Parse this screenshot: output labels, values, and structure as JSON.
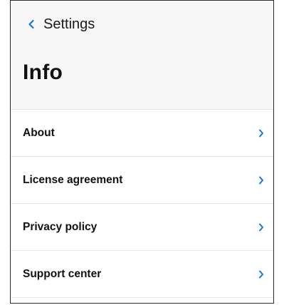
{
  "nav": {
    "back_label": "Settings",
    "back_icon": "chevron-left-icon"
  },
  "page": {
    "title": "Info"
  },
  "items": [
    {
      "label": "About",
      "icon": "chevron-right-icon"
    },
    {
      "label": "License agreement",
      "icon": "chevron-right-icon"
    },
    {
      "label": "Privacy policy",
      "icon": "chevron-right-icon"
    },
    {
      "label": "Support center",
      "icon": "chevron-right-icon"
    }
  ],
  "colors": {
    "accent": "#1a73e8",
    "text": "#111111",
    "header_bg": "#f6f6f6",
    "divider": "#e6e6e6"
  }
}
